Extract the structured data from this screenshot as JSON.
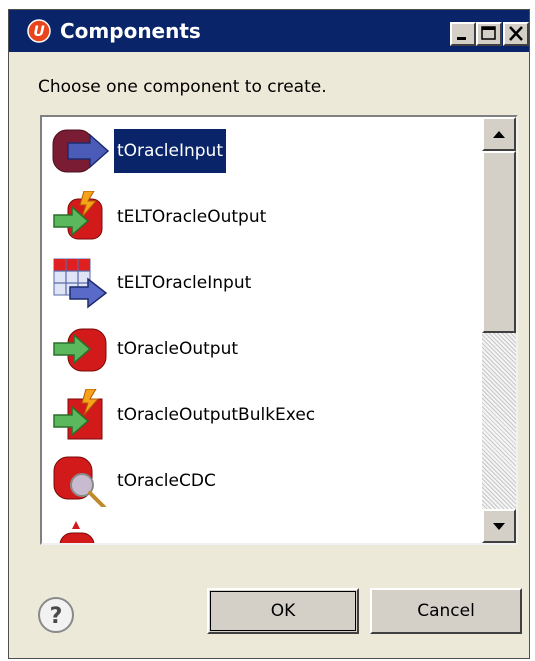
{
  "window": {
    "title": "Components",
    "app_icon": "talend-icon",
    "controls": {
      "minimize": "minimize-icon",
      "maximize": "maximize-icon",
      "close": "close-icon"
    }
  },
  "dialog": {
    "prompt": "Choose one component to create."
  },
  "components": [
    {
      "label": "tOracleInput",
      "icon": "oracle-input-icon",
      "selected": true
    },
    {
      "label": "tELTOracleOutput",
      "icon": "elt-oracle-output-icon",
      "selected": false
    },
    {
      "label": "tELTOracleInput",
      "icon": "elt-oracle-input-icon",
      "selected": false
    },
    {
      "label": "tOracleOutput",
      "icon": "oracle-output-icon",
      "selected": false
    },
    {
      "label": "tOracleOutputBulkExec",
      "icon": "oracle-output-bulk-exec-icon",
      "selected": false
    },
    {
      "label": "tOracleCDC",
      "icon": "oracle-cdc-icon",
      "selected": false
    },
    {
      "label": "",
      "icon": "oracle-partial-icon",
      "selected": false
    }
  ],
  "buttons": {
    "help_icon": "help-icon",
    "ok": "OK",
    "cancel": "Cancel"
  },
  "colors": {
    "title_bar": "#0a246a",
    "selection": "#0a246a",
    "dialog_bg": "#ece9d8"
  }
}
